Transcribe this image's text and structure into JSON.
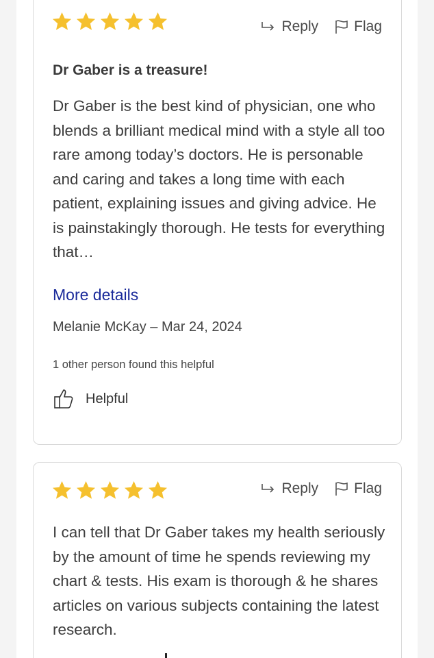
{
  "reviews": [
    {
      "rating": 5,
      "reply_label": "Reply",
      "flag_label": "Flag",
      "title": "Dr Gaber is a treasure!",
      "body": "Dr Gaber is the best kind of physician, one who blends a brilliant medical mind with a style all too rare among today’s doctors. He is personable and caring and takes a long time with each patient, explaining issues and giving advice. He is painstakingly thorough. He tests for everything that…",
      "more_label": "More details",
      "author_line": "Melanie McKay – Mar 24, 2024",
      "helpful_count_text": "1 other person found this helpful",
      "helpful_label": "Helpful"
    },
    {
      "rating": 5,
      "reply_label": "Reply",
      "flag_label": "Flag",
      "body": "I can tell that Dr Gaber takes my health seriously by the amount of time he spends reviewing my chart & tests. His exam is thorough & he shares articles on various subjects containing the latest research."
    }
  ],
  "colors": {
    "star": "#f5c02e",
    "link": "#1a2a9a",
    "border": "#d9d9d9"
  },
  "icons": [
    "star-icon",
    "reply-arrow-icon",
    "flag-icon",
    "thumbs-up-icon"
  ]
}
